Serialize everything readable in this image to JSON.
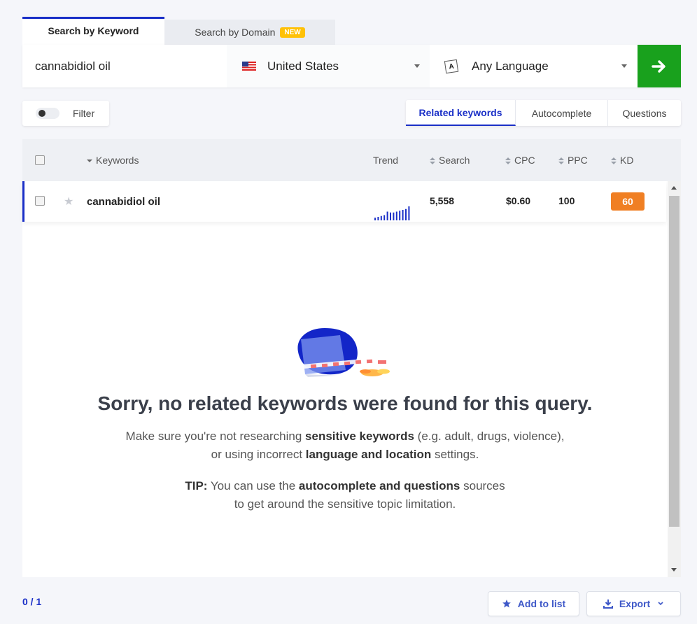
{
  "tabs": {
    "keyword": "Search by Keyword",
    "domain": "Search by Domain",
    "domain_badge": "NEW"
  },
  "search": {
    "keyword_value": "cannabidiol oil",
    "country": "United States",
    "language": "Any Language",
    "go_icon": "arrow-right-icon",
    "accent_color": "#19a11d"
  },
  "filter": {
    "label": "Filter"
  },
  "source_tabs": [
    "Related keywords",
    "Autocomplete",
    "Questions"
  ],
  "table": {
    "columns": {
      "keywords": "Keywords",
      "trend": "Trend",
      "search": "Search",
      "cpc": "CPC",
      "ppc": "PPC",
      "kd": "KD"
    },
    "rows": [
      {
        "keyword": "cannabidiol oil",
        "trend": [
          3,
          4,
          5,
          6,
          10,
          9,
          9,
          10,
          11,
          12,
          13,
          16
        ],
        "search": "5,558",
        "cpc": "$0.60",
        "ppc": "100",
        "kd": "60",
        "kd_color": "#f07f23"
      }
    ]
  },
  "empty_state": {
    "title": "Sorry, no related keywords were found for this query.",
    "line1_a": "Make sure you're not researching ",
    "line1_b": "sensitive keywords",
    "line1_c": " (e.g. adult, drugs, violence),",
    "line2_a": "or using incorrect ",
    "line2_b": "language and location",
    "line2_c": " settings.",
    "tip_label": "TIP:",
    "tip_a": " You can use the ",
    "tip_b": "autocomplete and questions",
    "tip_c": " sources",
    "tip_line2": "to get around the sensitive topic limitation."
  },
  "footer": {
    "counter": "0 / 1",
    "add_to_list": "Add to list",
    "export": "Export"
  }
}
